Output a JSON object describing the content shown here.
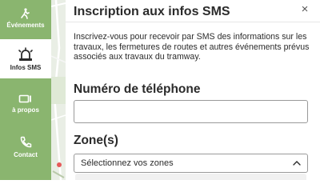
{
  "nav": {
    "events_label": "Événements",
    "sms_label": "Infos SMS",
    "about_label": "à propos",
    "contact_label": "Contact"
  },
  "dialog": {
    "title": "Inscription aux infos SMS",
    "close_symbol": "×",
    "intro": "Inscrivez-vous pour recevoir par SMS des informations sur les travaux, les fermetures de routes et autres événements prévus associés aux travaux du tramway.",
    "phone_label": "Numéro de téléphone",
    "phone_value": "",
    "zones_label": "Zone(s)",
    "zones_placeholder": "Sélectionnez vos zones"
  },
  "colors": {
    "sidebar": "#8ab56f",
    "text": "#2b2b2b"
  }
}
